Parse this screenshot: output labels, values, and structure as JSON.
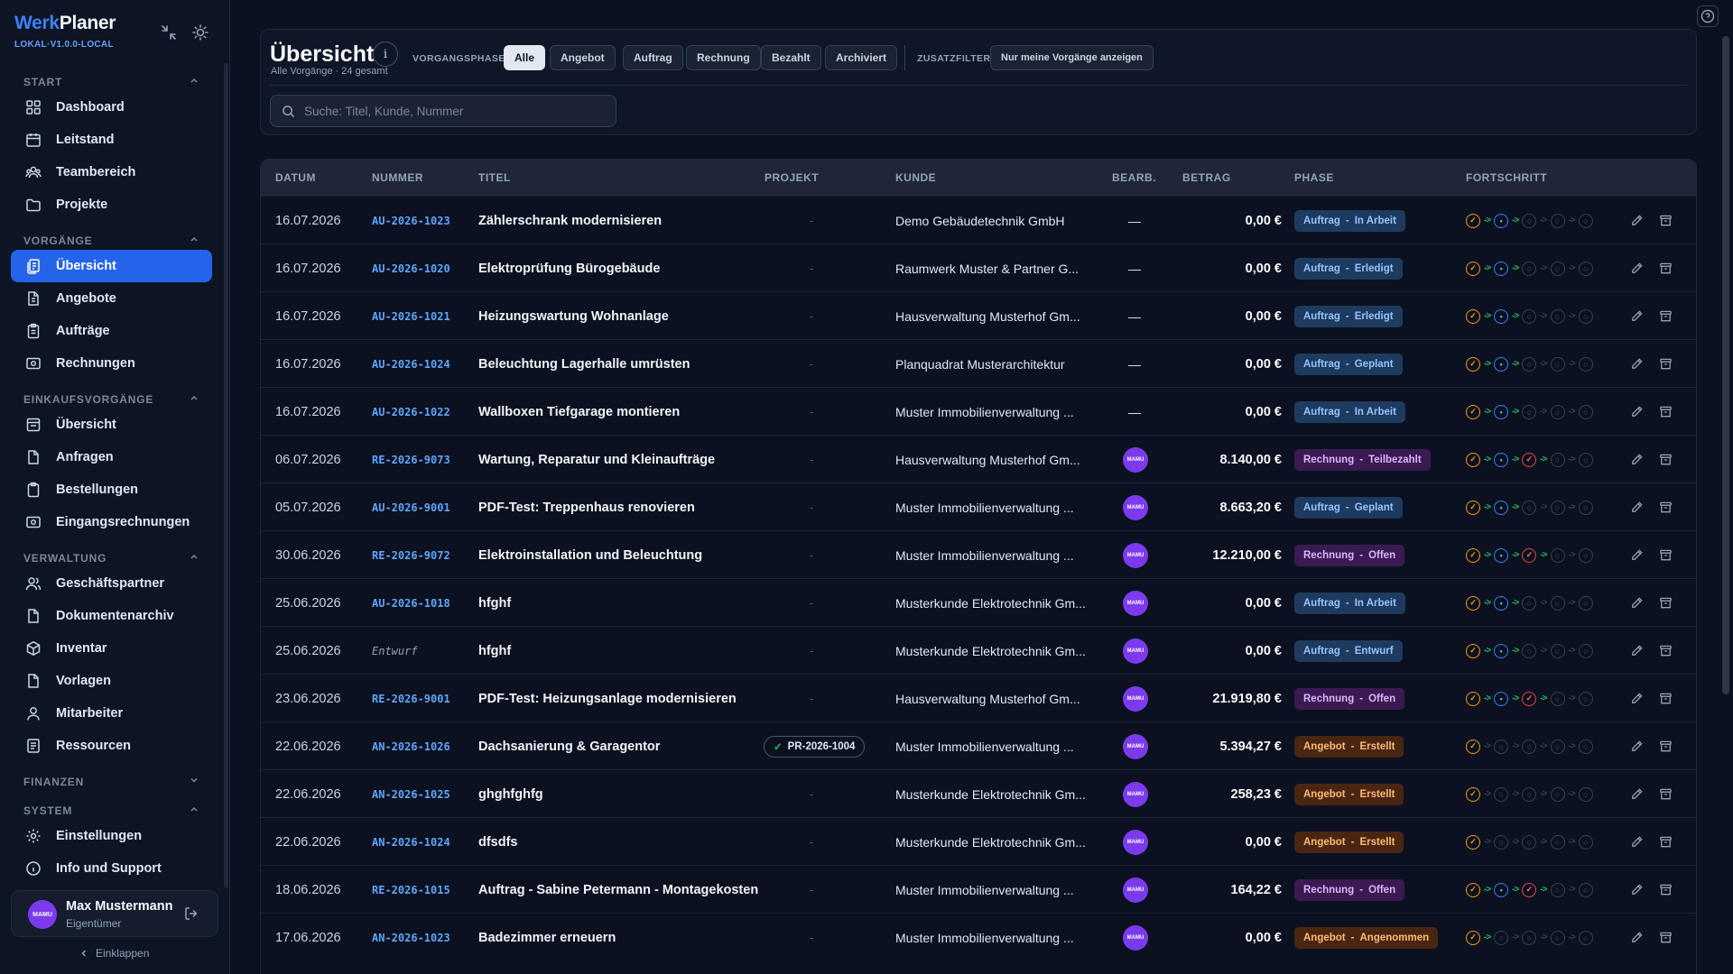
{
  "app": {
    "brand_werk": "Werk",
    "brand_planer": "Planer",
    "version": "LOKAL·V1.0.0-LOCAL"
  },
  "sidebar": {
    "start": {
      "title": "START",
      "items": [
        {
          "label": "Dashboard"
        },
        {
          "label": "Leitstand"
        },
        {
          "label": "Teambereich"
        },
        {
          "label": "Projekte"
        }
      ]
    },
    "vorgaenge": {
      "title": "VORGÄNGE",
      "items": [
        {
          "label": "Übersicht"
        },
        {
          "label": "Angebote"
        },
        {
          "label": "Aufträge"
        },
        {
          "label": "Rechnungen"
        }
      ]
    },
    "einkauf": {
      "title": "EINKAUFSVORGÄNGE",
      "items": [
        {
          "label": "Übersicht"
        },
        {
          "label": "Anfragen"
        },
        {
          "label": "Bestellungen"
        },
        {
          "label": "Eingangsrechnungen"
        }
      ]
    },
    "verwaltung": {
      "title": "VERWALTUNG",
      "items": [
        {
          "label": "Geschäftspartner"
        },
        {
          "label": "Dokumentenarchiv"
        },
        {
          "label": "Inventar"
        },
        {
          "label": "Vorlagen"
        },
        {
          "label": "Mitarbeiter"
        },
        {
          "label": "Ressourcen"
        }
      ]
    },
    "finanzen": {
      "title": "FINANZEN"
    },
    "system": {
      "title": "SYSTEM",
      "items": [
        {
          "label": "Einstellungen"
        },
        {
          "label": "Info und Support"
        }
      ]
    },
    "user": {
      "name": "Max Mustermann",
      "role": "Eigentümer",
      "initials": "MAMU"
    },
    "collapse_label": "Einklappen"
  },
  "header": {
    "title": "Übersicht",
    "info": "i",
    "subtitle": "Alle Vorgänge · 24 gesamt",
    "phase_label": "VORGANGSPHASE",
    "phases": [
      "Alle",
      "Angebot",
      "Auftrag",
      "Rechnung",
      "Bezahlt",
      "Archiviert"
    ],
    "active_phase": "Alle",
    "extra_label": "ZUSATZFILTER",
    "extra_filter": "Nur meine Vorgänge anzeigen",
    "search_placeholder": "Suche: Titel, Kunde, Nummer"
  },
  "table": {
    "columns": [
      "DATUM",
      "NUMMER",
      "TITEL",
      "PROJEKT",
      "KUNDE",
      "BEARB.",
      "BETRAG",
      "PHASE",
      "FORTSCHRITT"
    ],
    "rows": [
      {
        "date": "16.07.2026",
        "number": "AU-2026-1023",
        "title": "Zählerschrank modernisieren",
        "project": "-",
        "customer": "Demo Gebäudetechnik GmbH",
        "editor": "—",
        "amount": "0,00 €",
        "phase": "Auftrag",
        "status": "In Arbeit",
        "kind": "auftrag",
        "progress": [
          "o",
          "b",
          "g",
          "g",
          "g"
        ],
        "arrows": [
          1,
          1,
          0,
          0
        ]
      },
      {
        "date": "16.07.2026",
        "number": "AU-2026-1020",
        "title": "Elektroprüfung Bürogebäude",
        "project": "-",
        "customer": "Raumwerk Muster & Partner G...",
        "editor": "—",
        "amount": "0,00 €",
        "phase": "Auftrag",
        "status": "Erledigt",
        "kind": "auftrag",
        "progress": [
          "o",
          "b",
          "g",
          "g",
          "g"
        ],
        "arrows": [
          1,
          1,
          0,
          0
        ]
      },
      {
        "date": "16.07.2026",
        "number": "AU-2026-1021",
        "title": "Heizungswartung Wohnanlage",
        "project": "-",
        "customer": "Hausverwaltung Musterhof Gm...",
        "editor": "—",
        "amount": "0,00 €",
        "phase": "Auftrag",
        "status": "Erledigt",
        "kind": "auftrag",
        "progress": [
          "o",
          "b",
          "g",
          "g",
          "g"
        ],
        "arrows": [
          1,
          1,
          0,
          0
        ]
      },
      {
        "date": "16.07.2026",
        "number": "AU-2026-1024",
        "title": "Beleuchtung Lagerhalle umrüsten",
        "project": "-",
        "customer": "Planquadrat Musterarchitektur",
        "editor": "—",
        "amount": "0,00 €",
        "phase": "Auftrag",
        "status": "Geplant",
        "kind": "auftrag",
        "progress": [
          "o",
          "b",
          "g",
          "g",
          "g"
        ],
        "arrows": [
          1,
          1,
          0,
          0
        ]
      },
      {
        "date": "16.07.2026",
        "number": "AU-2026-1022",
        "title": "Wallboxen Tiefgarage montieren",
        "project": "-",
        "customer": "Muster Immobilienverwaltung ...",
        "editor": "—",
        "amount": "0,00 €",
        "phase": "Auftrag",
        "status": "In Arbeit",
        "kind": "auftrag",
        "progress": [
          "o",
          "b",
          "g",
          "g",
          "g"
        ],
        "arrows": [
          1,
          1,
          0,
          0
        ]
      },
      {
        "date": "06.07.2026",
        "number": "RE-2026-9073",
        "title": "Wartung, Reparatur und Kleinaufträge",
        "project": "-",
        "customer": "Hausverwaltung Musterhof Gm...",
        "editor": "MAMU",
        "amount": "8.140,00 €",
        "phase": "Rechnung",
        "status": "Teilbezahlt",
        "kind": "rechnung",
        "progress": [
          "o",
          "b",
          "r",
          "g",
          "g"
        ],
        "arrows": [
          1,
          1,
          1,
          0
        ]
      },
      {
        "date": "05.07.2026",
        "number": "AU-2026-9001",
        "title": "PDF-Test: Treppenhaus renovieren",
        "project": "-",
        "customer": "Muster Immobilienverwaltung ...",
        "editor": "MAMU",
        "amount": "8.663,20 €",
        "phase": "Auftrag",
        "status": "Geplant",
        "kind": "auftrag",
        "progress": [
          "o",
          "b",
          "g",
          "g",
          "g"
        ],
        "arrows": [
          1,
          1,
          0,
          0
        ]
      },
      {
        "date": "30.06.2026",
        "number": "RE-2026-9072",
        "title": "Elektroinstallation und Beleuchtung",
        "project": "-",
        "customer": "Muster Immobilienverwaltung ...",
        "editor": "MAMU",
        "amount": "12.210,00 €",
        "phase": "Rechnung",
        "status": "Offen",
        "kind": "rechnung",
        "progress": [
          "o",
          "b",
          "r",
          "g",
          "g"
        ],
        "arrows": [
          1,
          1,
          1,
          0
        ]
      },
      {
        "date": "25.06.2026",
        "number": "AU-2026-1018",
        "title": "hfghf",
        "project": "-",
        "customer": "Musterkunde Elektrotechnik Gm...",
        "editor": "MAMU",
        "amount": "0,00 €",
        "phase": "Auftrag",
        "status": "In Arbeit",
        "kind": "auftrag",
        "progress": [
          "o",
          "b",
          "g",
          "g",
          "g"
        ],
        "arrows": [
          1,
          1,
          0,
          0
        ]
      },
      {
        "date": "25.06.2026",
        "number": "Entwurf",
        "title": "hfghf",
        "project": "-",
        "customer": "Musterkunde Elektrotechnik Gm...",
        "editor": "MAMU",
        "amount": "0,00 €",
        "phase": "Auftrag",
        "status": "Entwurf",
        "kind": "auftrag",
        "progress": [
          "o",
          "b",
          "g",
          "g",
          "g"
        ],
        "arrows": [
          1,
          1,
          0,
          0
        ]
      },
      {
        "date": "23.06.2026",
        "number": "RE-2026-9001",
        "title": "PDF-Test: Heizungsanlage modernisieren",
        "project": "-",
        "customer": "Hausverwaltung Musterhof Gm...",
        "editor": "MAMU",
        "amount": "21.919,80 €",
        "phase": "Rechnung",
        "status": "Offen",
        "kind": "rechnung",
        "progress": [
          "o",
          "b",
          "r",
          "g",
          "g"
        ],
        "arrows": [
          1,
          1,
          1,
          0
        ]
      },
      {
        "date": "22.06.2026",
        "number": "AN-2026-1026",
        "title": "Dachsanierung & Garagentor",
        "project": "PR-2026-1004",
        "customer": "Muster Immobilienverwaltung ...",
        "editor": "MAMU",
        "amount": "5.394,27 €",
        "phase": "Angebot",
        "status": "Erstellt",
        "kind": "angebot",
        "progress": [
          "o",
          "g",
          "g",
          "g",
          "g"
        ],
        "arrows": [
          0,
          0,
          0,
          0
        ]
      },
      {
        "date": "22.06.2026",
        "number": "AN-2026-1025",
        "title": "ghghfghfg",
        "project": "-",
        "customer": "Musterkunde Elektrotechnik Gm...",
        "editor": "MAMU",
        "amount": "258,23 €",
        "phase": "Angebot",
        "status": "Erstellt",
        "kind": "angebot",
        "progress": [
          "o",
          "g",
          "g",
          "g",
          "g"
        ],
        "arrows": [
          0,
          0,
          0,
          0
        ]
      },
      {
        "date": "22.06.2026",
        "number": "AN-2026-1024",
        "title": "dfsdfs",
        "project": "-",
        "customer": "Musterkunde Elektrotechnik Gm...",
        "editor": "MAMU",
        "amount": "0,00 €",
        "phase": "Angebot",
        "status": "Erstellt",
        "kind": "angebot",
        "progress": [
          "o",
          "g",
          "g",
          "g",
          "g"
        ],
        "arrows": [
          0,
          0,
          0,
          0
        ]
      },
      {
        "date": "18.06.2026",
        "number": "RE-2026-1015",
        "title": "Auftrag - Sabine Petermann - Montagekosten",
        "project": "-",
        "customer": "Muster Immobilienverwaltung ...",
        "editor": "MAMU",
        "amount": "164,22 €",
        "phase": "Rechnung",
        "status": "Offen",
        "kind": "rechnung",
        "progress": [
          "o",
          "b",
          "r",
          "g",
          "g"
        ],
        "arrows": [
          1,
          1,
          1,
          0
        ]
      },
      {
        "date": "17.06.2026",
        "number": "AN-2026-1023",
        "title": "Badezimmer erneuern",
        "project": "-",
        "customer": "Muster Immobilienverwaltung ...",
        "editor": "MAMU",
        "amount": "0,00 €",
        "phase": "Angebot",
        "status": "Angenommen",
        "kind": "angebot",
        "progress": [
          "o",
          "g",
          "g",
          "g",
          "g"
        ],
        "arrows": [
          1,
          0,
          0,
          0
        ]
      }
    ]
  },
  "colors": {
    "accent": "#2563eb",
    "link": "#60a5fa",
    "bg": "#0b1120",
    "auftrag": "#93c5fd",
    "rechnung": "#d8b4fe",
    "angebot": "#fdba74",
    "arrow_on": "#22c55e"
  }
}
